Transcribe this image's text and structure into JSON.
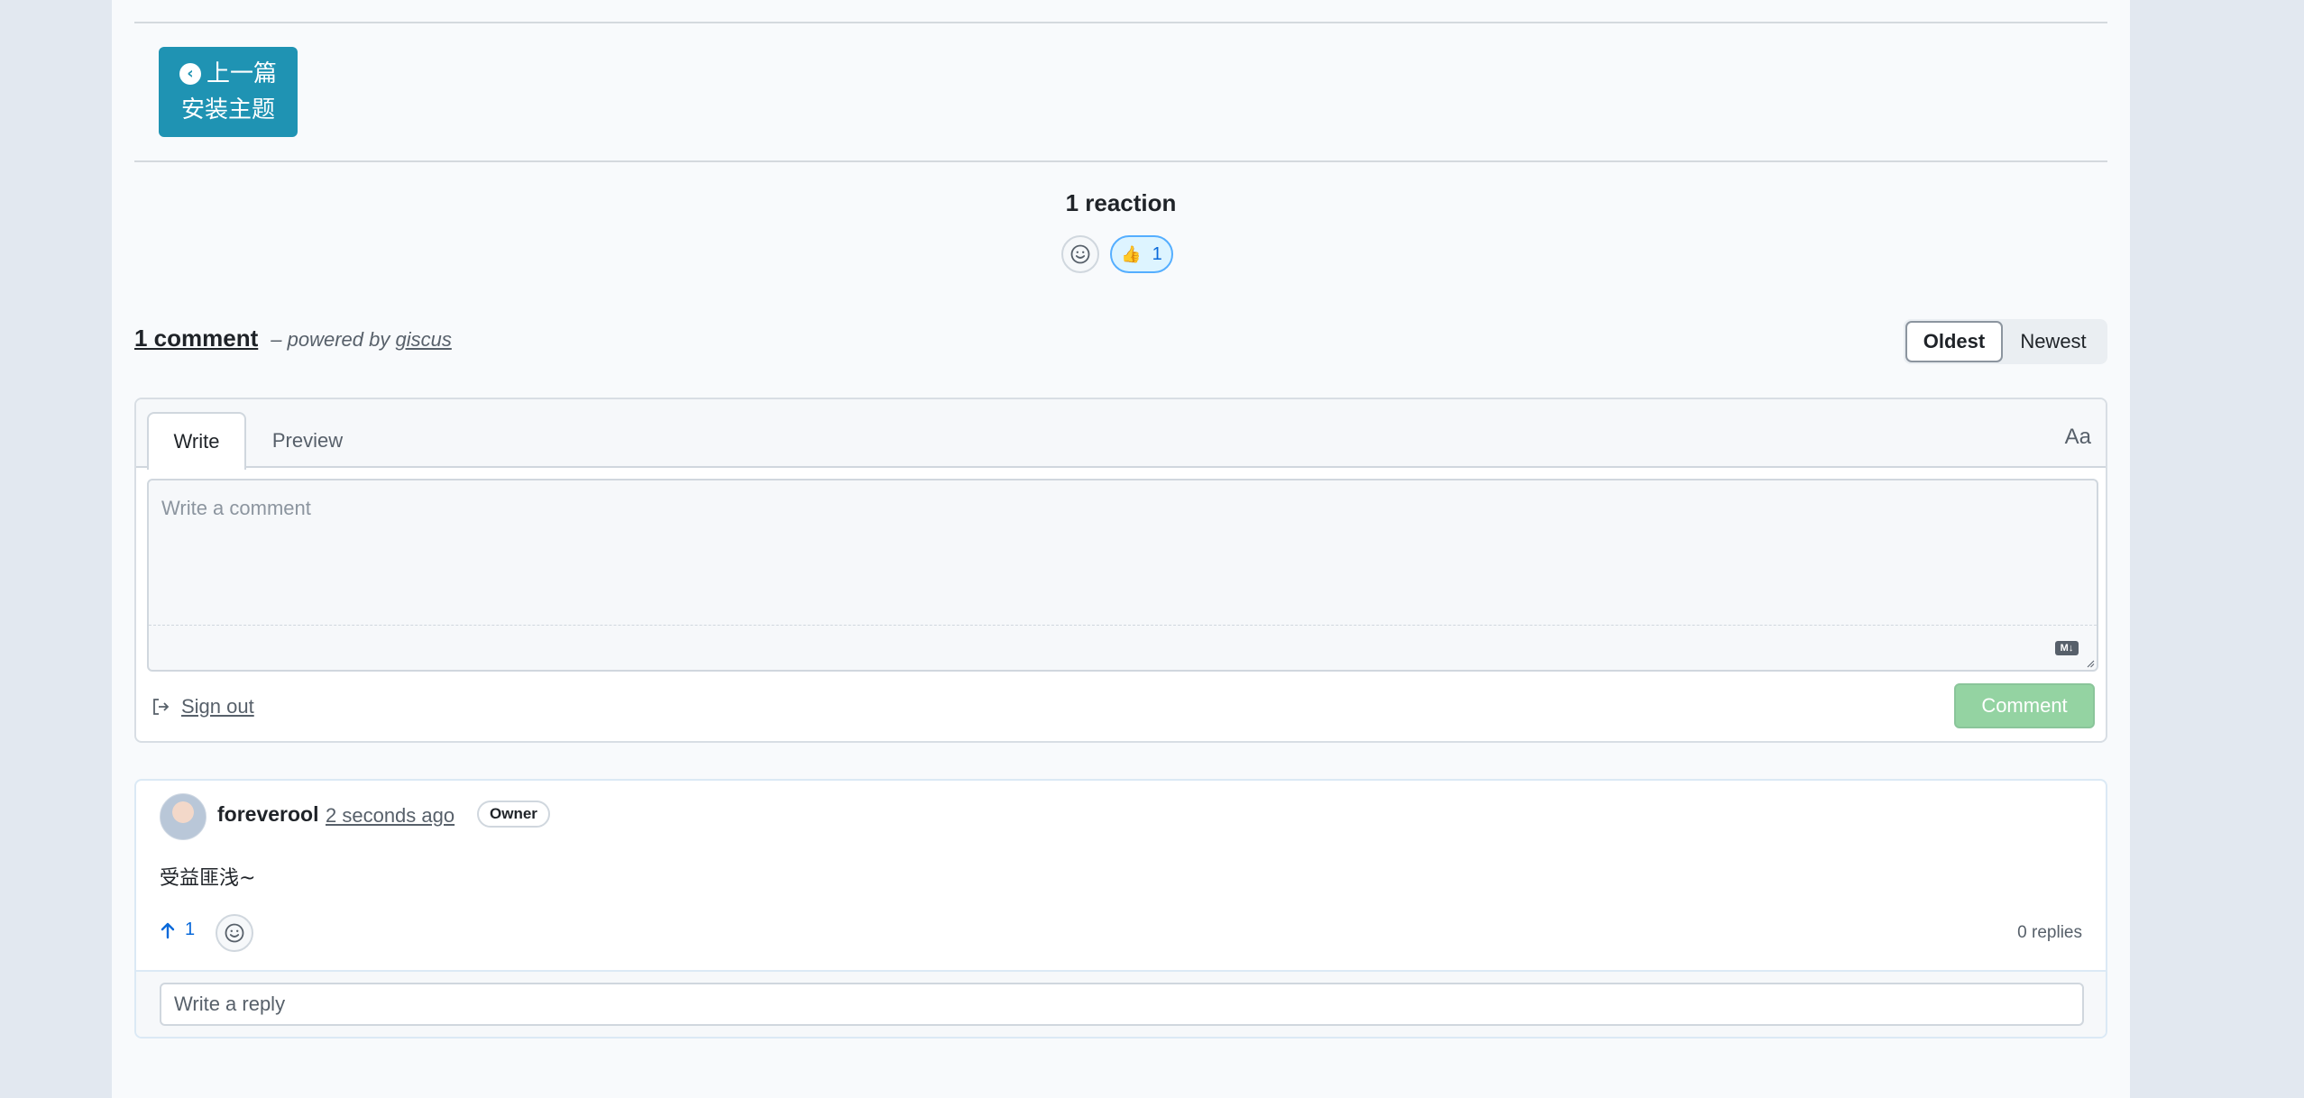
{
  "navigation": {
    "prev_label": "上一篇",
    "prev_title": "安装主题"
  },
  "reactions": {
    "title": "1 reaction",
    "items": [
      {
        "emoji": "👍",
        "count": "1"
      }
    ]
  },
  "comments_header": {
    "count_label": "1 comment",
    "powered_prefix": "– powered by",
    "powered_link": "giscus"
  },
  "sort": {
    "oldest": "Oldest",
    "newest": "Newest",
    "selected": "Oldest"
  },
  "editor": {
    "tab_write": "Write",
    "tab_preview": "Preview",
    "format_toggle": "Aa",
    "placeholder": "Write a comment",
    "markdown_badge": "M↓",
    "sign_out": "Sign out",
    "submit": "Comment"
  },
  "comment": {
    "author": "foreverool",
    "time": "2 seconds ago",
    "badge": "Owner",
    "body": "受益匪浅~",
    "upvotes": "1",
    "replies": "0 replies",
    "reply_placeholder": "Write a reply"
  },
  "colors": {
    "prev_button": "#1f93b3",
    "reaction_active_bg": "#ddf4ff",
    "comment_button_disabled": "#94d3a2",
    "upvote": "#0969da"
  },
  "icons": {
    "prev": "chevron-left-circle-icon",
    "add_reaction": "smiley-icon",
    "sign_out": "sign-out-icon",
    "upvote": "arrow-up-icon",
    "markdown": "markdown-icon"
  }
}
